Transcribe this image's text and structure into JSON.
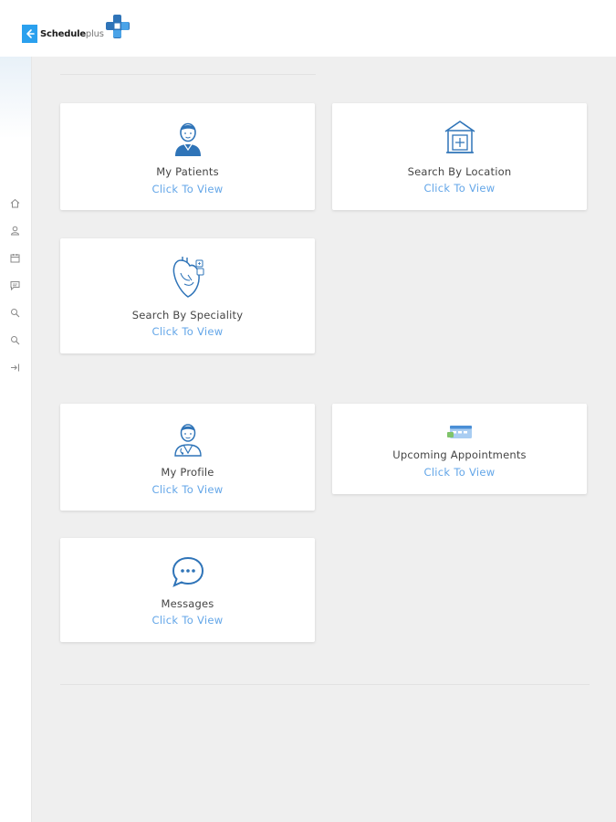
{
  "app": {
    "brand_bold": "Schedule",
    "brand_light": "plus"
  },
  "cards": [
    {
      "title": "My Patients",
      "link": "Click To View",
      "icon": "patient-icon"
    },
    {
      "title": "Search By Location",
      "link": "Click To View",
      "icon": "hospital-building-icon"
    },
    {
      "title": "Search By Speciality",
      "link": "Click To View",
      "icon": "heart-organ-icon"
    },
    {
      "title": "My Profile",
      "link": "Click To View",
      "icon": "doctor-profile-icon"
    },
    {
      "title": "Upcoming Appointments",
      "link": "Click To View",
      "icon": "appointment-icon"
    },
    {
      "title": "Messages",
      "link": "Click To View",
      "icon": "chat-bubble-icon"
    }
  ],
  "sidebar": {
    "icons": [
      "home-icon",
      "user-icon",
      "calendar-icon",
      "message-icon",
      "search-icon",
      "search-icon",
      "logout-icon"
    ]
  },
  "colors": {
    "accent": "#2aa0ee",
    "link": "#63a6e8",
    "icon_blue": "#2f74b8",
    "background": "#efefef"
  }
}
